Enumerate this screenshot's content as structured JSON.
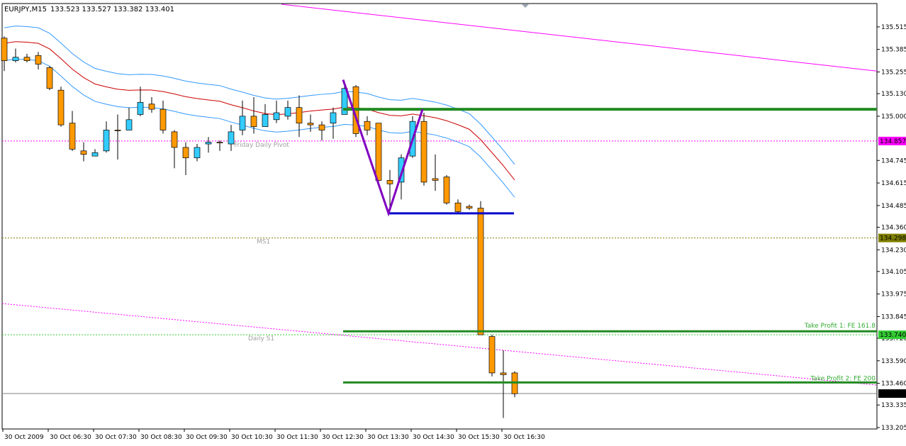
{
  "chart_data": {
    "type": "candlestick",
    "header": {
      "symbol": "EURJPY,M15",
      "ohlc": "133.523 133.527 133.382 133.401"
    },
    "y_axis": {
      "min": 133.205,
      "max": 135.58,
      "tick_labels": [
        "135.515",
        "135.385",
        "135.255",
        "135.130",
        "135.000",
        "134.745",
        "134.615",
        "134.485",
        "134.360",
        "134.230",
        "134.105",
        "133.975",
        "133.845",
        "133.720",
        "133.590",
        "133.460",
        "133.335",
        "133.205"
      ],
      "tick_values": [
        135.515,
        135.385,
        135.255,
        135.13,
        135.0,
        134.745,
        134.615,
        134.485,
        134.36,
        134.23,
        134.105,
        133.975,
        133.845,
        133.72,
        133.59,
        133.46,
        133.335,
        133.205
      ]
    },
    "x_axis": {
      "labels": [
        "30 Oct 2009",
        "30 Oct 06:30",
        "30 Oct 07:30",
        "30 Oct 08:30",
        "30 Oct 09:30",
        "30 Oct 10:30",
        "30 Oct 11:30",
        "30 Oct 12:30",
        "30 Oct 13:30",
        "30 Oct 14:30",
        "30 Oct 15:30",
        "30 Oct 16:30"
      ],
      "label_bar_index": [
        0,
        4,
        8,
        12,
        16,
        20,
        24,
        28,
        32,
        36,
        40,
        44
      ]
    },
    "candles": [
      {
        "o": 135.45,
        "h": 135.46,
        "c": 135.32,
        "l": 135.26
      },
      {
        "o": 135.32,
        "h": 135.39,
        "c": 135.34,
        "l": 135.31
      },
      {
        "o": 135.34,
        "h": 135.36,
        "c": 135.32,
        "l": 135.31
      },
      {
        "o": 135.35,
        "h": 135.37,
        "c": 135.3,
        "l": 135.27
      },
      {
        "o": 135.28,
        "h": 135.29,
        "c": 135.16,
        "l": 135.15
      },
      {
        "o": 135.15,
        "h": 135.17,
        "c": 134.95,
        "l": 134.94
      },
      {
        "o": 134.96,
        "h": 135.03,
        "c": 134.81,
        "l": 134.8
      },
      {
        "o": 134.8,
        "h": 134.85,
        "c": 134.78,
        "l": 134.74
      },
      {
        "o": 134.77,
        "h": 134.81,
        "c": 134.79,
        "l": 134.77
      },
      {
        "o": 134.8,
        "h": 134.97,
        "c": 134.92,
        "l": 134.79
      },
      {
        "o": 134.92,
        "h": 135.01,
        "c": 134.92,
        "l": 134.75
      },
      {
        "o": 134.92,
        "h": 135.05,
        "c": 134.98,
        "l": 134.92
      },
      {
        "o": 135.01,
        "h": 135.17,
        "c": 135.08,
        "l": 135.0
      },
      {
        "o": 135.07,
        "h": 135.11,
        "c": 135.04,
        "l": 135.02
      },
      {
        "o": 135.04,
        "h": 135.09,
        "c": 134.92,
        "l": 134.9
      },
      {
        "o": 134.91,
        "h": 134.92,
        "c": 134.82,
        "l": 134.7
      },
      {
        "o": 134.82,
        "h": 134.85,
        "c": 134.76,
        "l": 134.66
      },
      {
        "o": 134.76,
        "h": 134.84,
        "c": 134.82,
        "l": 134.74
      },
      {
        "o": 134.84,
        "h": 134.88,
        "c": 134.85,
        "l": 134.79
      },
      {
        "o": 134.85,
        "h": 134.86,
        "c": 134.85,
        "l": 134.8
      },
      {
        "o": 134.84,
        "h": 134.95,
        "c": 134.91,
        "l": 134.8
      },
      {
        "o": 134.92,
        "h": 135.09,
        "c": 135.0,
        "l": 134.89
      },
      {
        "o": 135.0,
        "h": 135.11,
        "c": 134.94,
        "l": 134.9
      },
      {
        "o": 134.94,
        "h": 135.07,
        "c": 135.01,
        "l": 134.94
      },
      {
        "o": 134.98,
        "h": 135.09,
        "c": 135.02,
        "l": 134.96
      },
      {
        "o": 135.0,
        "h": 135.09,
        "c": 135.05,
        "l": 134.98
      },
      {
        "o": 135.05,
        "h": 135.12,
        "c": 134.96,
        "l": 134.88
      },
      {
        "o": 134.96,
        "h": 135.01,
        "c": 134.95,
        "l": 134.91
      },
      {
        "o": 134.95,
        "h": 134.97,
        "c": 134.92,
        "l": 134.86
      },
      {
        "o": 134.96,
        "h": 135.05,
        "c": 135.02,
        "l": 134.87
      },
      {
        "o": 135.01,
        "h": 135.17,
        "c": 135.16,
        "l": 135.01
      },
      {
        "o": 135.17,
        "h": 135.18,
        "c": 134.9,
        "l": 134.88
      },
      {
        "o": 134.97,
        "h": 135.0,
        "c": 134.92,
        "l": 134.89
      },
      {
        "o": 134.96,
        "h": 134.96,
        "c": 134.63,
        "l": 134.6
      },
      {
        "o": 134.63,
        "h": 134.69,
        "c": 134.61,
        "l": 134.48
      },
      {
        "o": 134.62,
        "h": 134.78,
        "c": 134.76,
        "l": 134.52
      },
      {
        "o": 134.77,
        "h": 135.0,
        "c": 134.97,
        "l": 134.76
      },
      {
        "o": 134.97,
        "h": 135.02,
        "c": 134.62,
        "l": 134.6
      },
      {
        "o": 134.64,
        "h": 134.78,
        "c": 134.63,
        "l": 134.57
      },
      {
        "o": 134.65,
        "h": 134.66,
        "c": 134.5,
        "l": 134.49
      },
      {
        "o": 134.5,
        "h": 134.52,
        "c": 134.45,
        "l": 134.44
      },
      {
        "o": 134.48,
        "h": 134.49,
        "c": 134.47,
        "l": 134.46
      },
      {
        "o": 134.47,
        "h": 134.51,
        "c": 133.74,
        "l": 133.74
      },
      {
        "o": 133.73,
        "h": 133.74,
        "c": 133.52,
        "l": 133.5
      },
      {
        "o": 133.52,
        "h": 133.65,
        "c": 133.51,
        "l": 133.26
      },
      {
        "o": 133.52,
        "h": 133.53,
        "c": 133.4,
        "l": 133.38
      }
    ],
    "price_labels": [
      {
        "text": "134.857",
        "value": 134.857,
        "color": "#ff00ff"
      },
      {
        "text": "134.298",
        "value": 134.298,
        "color": "#808000"
      },
      {
        "text": "133.740",
        "value": 133.74,
        "color": "#33cc33"
      },
      {
        "text": "133.401",
        "value": 133.401,
        "color": "#000000"
      }
    ],
    "level_lines": [
      {
        "name": "Friday  Daily Pivot",
        "value": 134.857,
        "color": "#ff00ff"
      },
      {
        "name": "MS1",
        "value": 134.298,
        "color": "#808000"
      },
      {
        "name": "Daily S1",
        "value": 133.74,
        "color": "#33cc33"
      }
    ],
    "take_profit_labels": [
      "Take Profit 1:  FE 161.8",
      "Take Profit 2: FE 200"
    ],
    "green_level_values": [
      135.04,
      133.76,
      133.465
    ],
    "neckline_value": 134.44,
    "colors": {
      "bull": "#33ccff",
      "bear": "#ff9900",
      "grid_line": "#000000",
      "ma_red": "#cc0000",
      "envelope": "#3399ff",
      "trend": "#ff00ff",
      "pattern": "#8000c0",
      "neckline": "#0000cc",
      "levels": "#228b22"
    }
  }
}
